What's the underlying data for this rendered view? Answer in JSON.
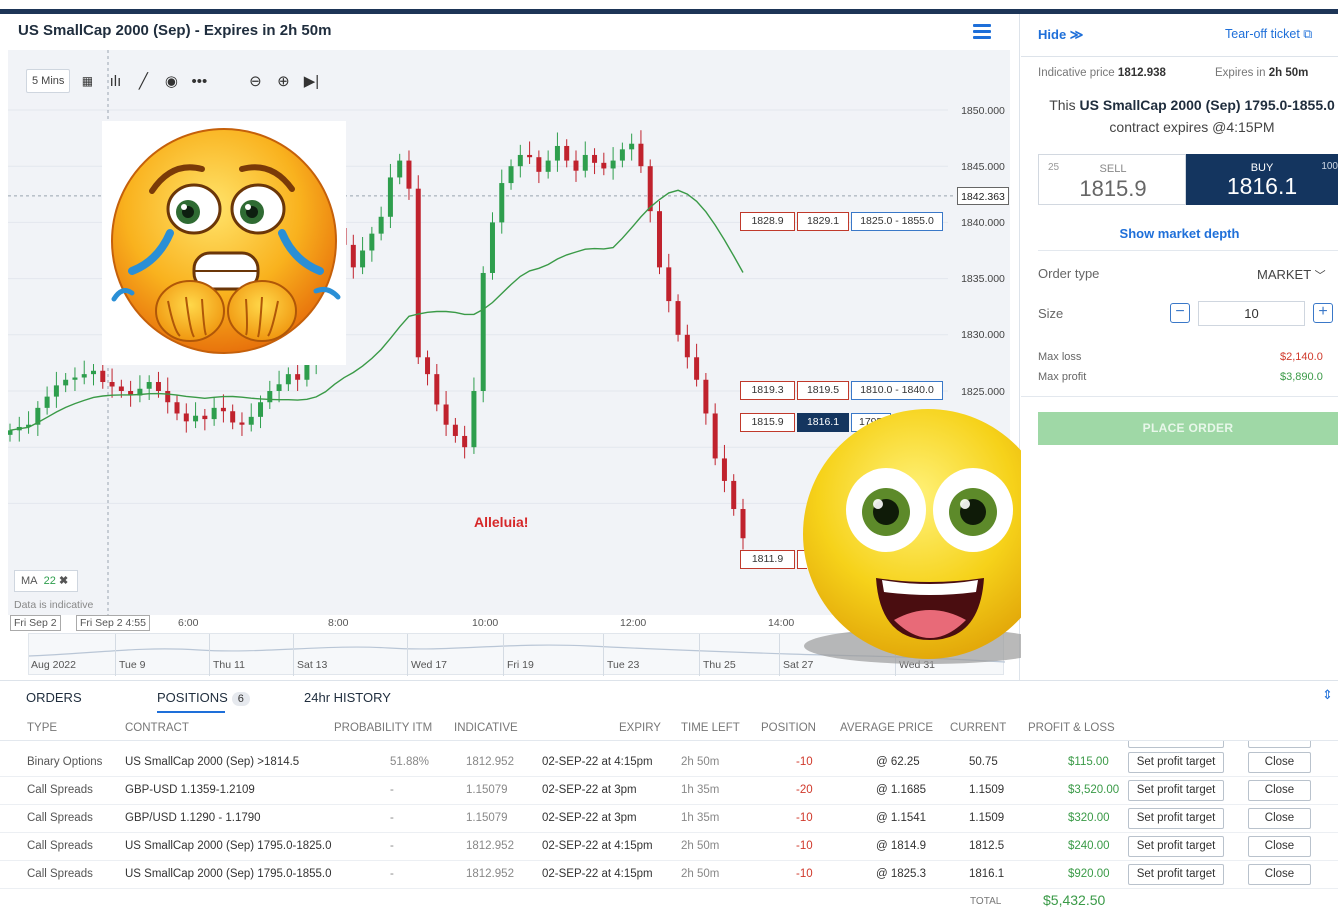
{
  "chart": {
    "title": "US SmallCap 2000 (Sep) - Expires in 2h 50m",
    "toolbar": {
      "interval": "5 Mins"
    },
    "price_axis": [
      "1850.000",
      "1845.000",
      "1840.000",
      "1835.000",
      "1830.000",
      "1825.000"
    ],
    "current_price": "1842.363",
    "levels": [
      {
        "sell": "1828.9",
        "buy": "1829.1",
        "range": "1825.0 - 1855.0"
      },
      {
        "sell": "1819.3",
        "buy": "1819.5",
        "range": "1810.0 - 1840.0"
      },
      {
        "sell": "1815.9",
        "buy": "1816.1",
        "range": "1795"
      },
      {
        "sell": "1811.9"
      }
    ],
    "ma_label": "MA",
    "ma_period": "22",
    "indicative_note": "Data is indicative",
    "annotation": "Alleluia!",
    "time_axis": [
      "Fri Sep 2",
      "Fri Sep 2 4:55",
      "6:00",
      "8:00",
      "10:00",
      "12:00",
      "14:00"
    ],
    "navigator_labels": [
      "Aug 2022",
      "Tue 9",
      "Thu 11",
      "Sat 13",
      "Wed 17",
      "Fri 19",
      "Tue 23",
      "Thu 25",
      "Sat 27",
      "Wed 31"
    ],
    "ma_color": "#3a9a47",
    "up_color": "#2e9e4d",
    "down_color": "#c0222d"
  },
  "ticket": {
    "hide_label": "Hide",
    "tearoff_label": "Tear-off ticket",
    "indicative_label": "Indicative price",
    "indicative_value": "1812.938",
    "expires_label": "Expires in",
    "expires_value": "2h 50m",
    "contract_prefix": "This",
    "contract_name": "US SmallCap 2000 (Sep) 1795.0-1855.0",
    "contract_suffix": "contract expires @4:15PM",
    "sell": {
      "qty": "25",
      "label": "SELL",
      "price": "1815.9"
    },
    "buy": {
      "qty": "100",
      "label": "BUY",
      "price": "1816.1"
    },
    "market_depth": "Show market depth",
    "order_type_label": "Order type",
    "order_type_value": "MARKET",
    "size_label": "Size",
    "size_value": "10",
    "max_loss_label": "Max loss",
    "max_loss_value": "$2,140.0",
    "max_profit_label": "Max profit",
    "max_profit_value": "$3,890.0",
    "place_order": "PLACE ORDER"
  },
  "bottom": {
    "tabs": {
      "orders": "ORDERS",
      "positions": "POSITIONS",
      "positions_count": "6",
      "history": "24hr HISTORY"
    },
    "columns": [
      "TYPE",
      "CONTRACT",
      "PROBABILITY ITM",
      "INDICATIVE",
      "EXPIRY",
      "TIME LEFT",
      "POSITION",
      "AVERAGE PRICE",
      "CURRENT",
      "PROFIT & LOSS"
    ],
    "rows": [
      {
        "type": "Binary Options",
        "contract": "US SmallCap 2000 (Sep) >1814.5",
        "prob": "51.88%",
        "indicative": "1812.952",
        "expiry": "02-SEP-22 at 4:15pm",
        "left": "2h 50m",
        "position": "-10",
        "avg": "@ 62.25",
        "current": "50.75",
        "pnl": "$115.00",
        "spt": "Set profit target",
        "close": "Close"
      },
      {
        "type": "Call Spreads",
        "contract": "GBP-USD 1.1359-1.2109",
        "prob": "-",
        "indicative": "1.15079",
        "expiry": "02-SEP-22 at 3pm",
        "left": "1h 35m",
        "position": "-20",
        "avg": "@ 1.1685",
        "current": "1.1509",
        "pnl": "$3,520.00",
        "spt": "Set profit target",
        "close": "Close"
      },
      {
        "type": "Call Spreads",
        "contract": "GBP/USD 1.1290 - 1.1790",
        "prob": "-",
        "indicative": "1.15079",
        "expiry": "02-SEP-22 at 3pm",
        "left": "1h 35m",
        "position": "-10",
        "avg": "@ 1.1541",
        "current": "1.1509",
        "pnl": "$320.00",
        "spt": "Set profit target",
        "close": "Close"
      },
      {
        "type": "Call Spreads",
        "contract": "US SmallCap 2000 (Sep) 1795.0-1825.0",
        "prob": "-",
        "indicative": "1812.952",
        "expiry": "02-SEP-22 at 4:15pm",
        "left": "2h 50m",
        "position": "-10",
        "avg": "@ 1814.9",
        "current": "1812.5",
        "pnl": "$240.00",
        "spt": "Set profit target",
        "close": "Close"
      },
      {
        "type": "Call Spreads",
        "contract": "US SmallCap 2000 (Sep) 1795.0-1855.0",
        "prob": "-",
        "indicative": "1812.952",
        "expiry": "02-SEP-22 at 4:15pm",
        "left": "2h 50m",
        "position": "-10",
        "avg": "@ 1825.3",
        "current": "1816.1",
        "pnl": "$920.00",
        "spt": "Set profit target",
        "close": "Close"
      }
    ],
    "total_label": "TOTAL",
    "total_value": "$5,432.50"
  }
}
